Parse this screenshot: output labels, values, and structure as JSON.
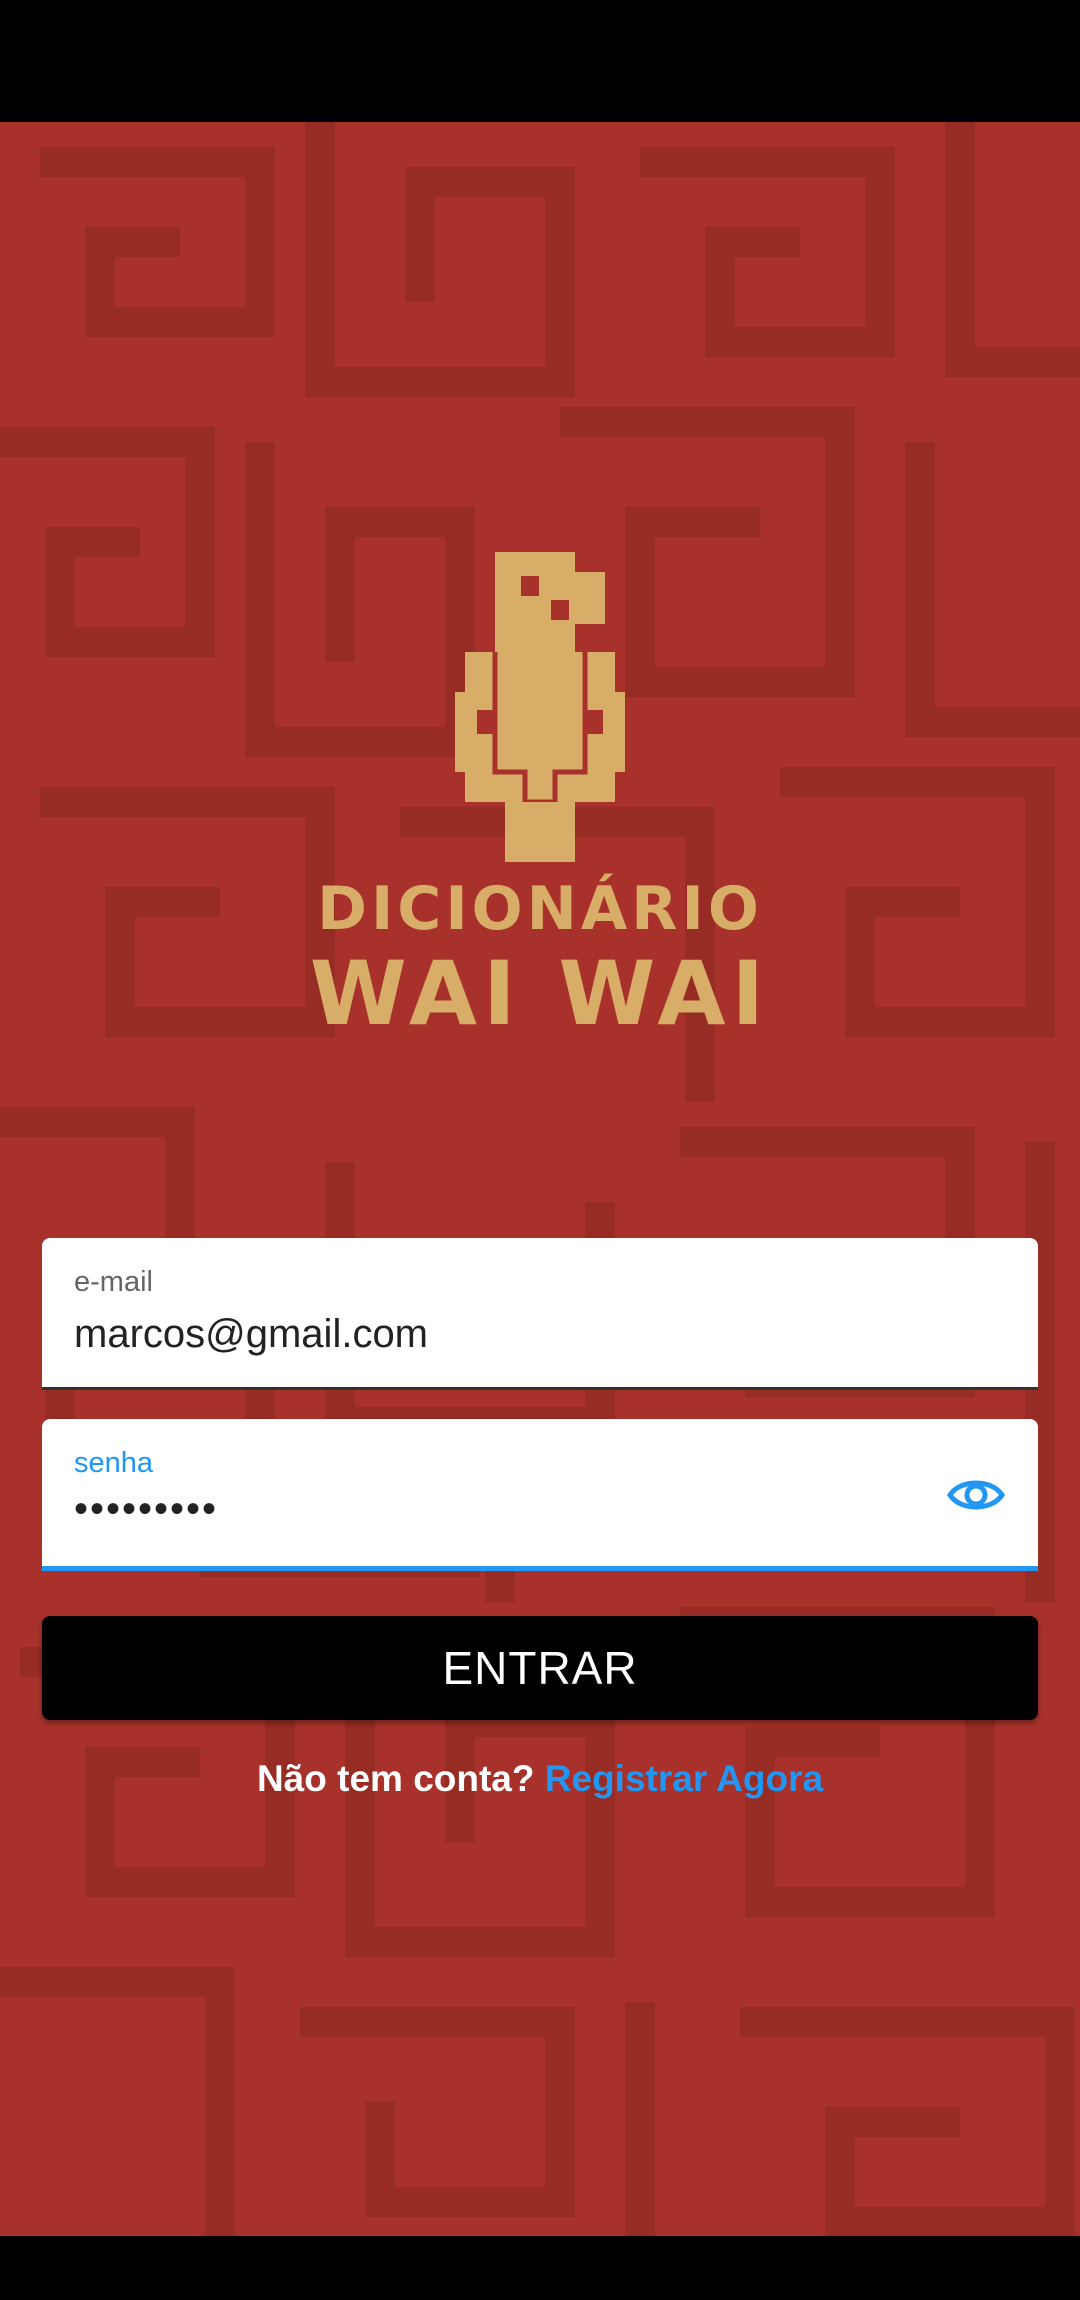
{
  "app": {
    "logo_line1": "DICIONÁRIO",
    "logo_line2": "WAI WAI"
  },
  "login": {
    "email_label": "e-mail",
    "email_value": "marcos@gmail.com",
    "password_label": "senha",
    "password_value": "•••••••••",
    "submit_label": "ENTRAR",
    "register_question": "Não tem conta?",
    "register_link": "Registrar Agora"
  },
  "icons": {
    "password_toggle": "eye-icon",
    "logo": "wai-wai-figure-logo"
  },
  "colors": {
    "background": "#a8322b",
    "pattern": "#972c25",
    "logo": "#d8ad67",
    "accent": "#2196f3",
    "button": "#000000"
  }
}
